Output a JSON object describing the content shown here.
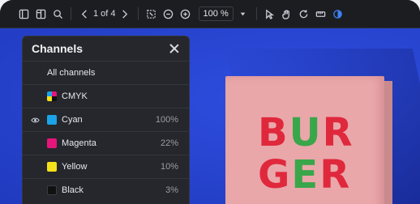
{
  "toolbar": {
    "page_indicator": "1 of 4",
    "zoom": "100 %",
    "icons": [
      "sidebar-icon",
      "panels-icon",
      "search-icon",
      "prev-icon",
      "next-icon",
      "select-area-icon",
      "zoom-out-icon",
      "zoom-in-icon",
      "dropdown-icon",
      "pointer-icon",
      "hand-icon",
      "rotate-icon",
      "ruler-icon",
      "contrast-icon"
    ]
  },
  "panel": {
    "title": "Channels",
    "all_label": "All channels",
    "channels": [
      {
        "label": "CMYK",
        "percent": "",
        "color": "cmyk",
        "visible": false
      },
      {
        "label": "Cyan",
        "percent": "100%",
        "color": "#1aa3e8",
        "visible": true
      },
      {
        "label": "Magenta",
        "percent": "22%",
        "color": "#e6157c",
        "visible": false
      },
      {
        "label": "Yellow",
        "percent": "10%",
        "color": "#f5e11a",
        "visible": false
      },
      {
        "label": "Black",
        "percent": "3%",
        "color": "#111111",
        "visible": false
      }
    ]
  },
  "artwork": {
    "line1": [
      "B",
      "U",
      "R"
    ],
    "line2": [
      "G",
      "E",
      "R"
    ],
    "colors": {
      "canvas": "#2747d6",
      "box": "#e9a7aa",
      "text": "#e0283c",
      "accent": "#3aa64a"
    }
  }
}
